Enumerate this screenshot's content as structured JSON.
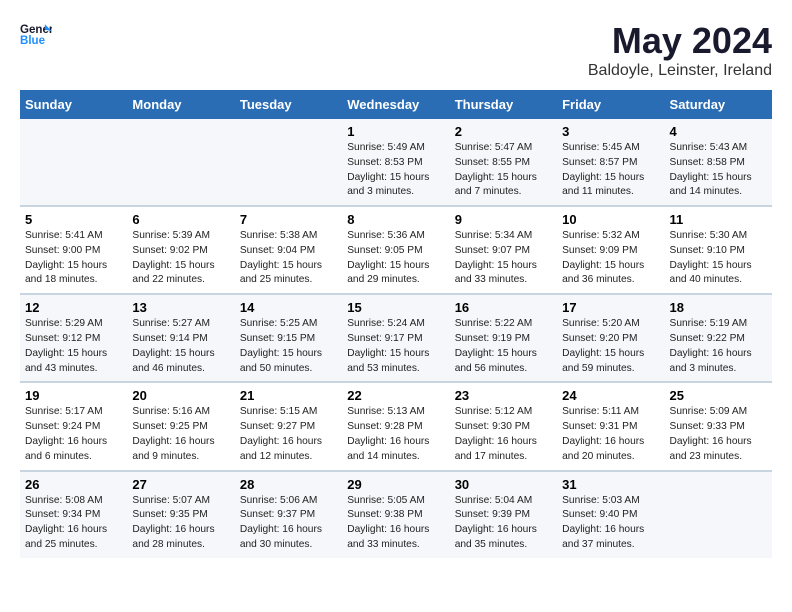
{
  "header": {
    "logo_line1": "General",
    "logo_line2": "Blue",
    "month": "May 2024",
    "location": "Baldoyle, Leinster, Ireland"
  },
  "weekdays": [
    "Sunday",
    "Monday",
    "Tuesday",
    "Wednesday",
    "Thursday",
    "Friday",
    "Saturday"
  ],
  "rows": [
    [
      {
        "day": "",
        "info": ""
      },
      {
        "day": "",
        "info": ""
      },
      {
        "day": "",
        "info": ""
      },
      {
        "day": "1",
        "info": "Sunrise: 5:49 AM\nSunset: 8:53 PM\nDaylight: 15 hours\nand 3 minutes."
      },
      {
        "day": "2",
        "info": "Sunrise: 5:47 AM\nSunset: 8:55 PM\nDaylight: 15 hours\nand 7 minutes."
      },
      {
        "day": "3",
        "info": "Sunrise: 5:45 AM\nSunset: 8:57 PM\nDaylight: 15 hours\nand 11 minutes."
      },
      {
        "day": "4",
        "info": "Sunrise: 5:43 AM\nSunset: 8:58 PM\nDaylight: 15 hours\nand 14 minutes."
      }
    ],
    [
      {
        "day": "5",
        "info": "Sunrise: 5:41 AM\nSunset: 9:00 PM\nDaylight: 15 hours\nand 18 minutes."
      },
      {
        "day": "6",
        "info": "Sunrise: 5:39 AM\nSunset: 9:02 PM\nDaylight: 15 hours\nand 22 minutes."
      },
      {
        "day": "7",
        "info": "Sunrise: 5:38 AM\nSunset: 9:04 PM\nDaylight: 15 hours\nand 25 minutes."
      },
      {
        "day": "8",
        "info": "Sunrise: 5:36 AM\nSunset: 9:05 PM\nDaylight: 15 hours\nand 29 minutes."
      },
      {
        "day": "9",
        "info": "Sunrise: 5:34 AM\nSunset: 9:07 PM\nDaylight: 15 hours\nand 33 minutes."
      },
      {
        "day": "10",
        "info": "Sunrise: 5:32 AM\nSunset: 9:09 PM\nDaylight: 15 hours\nand 36 minutes."
      },
      {
        "day": "11",
        "info": "Sunrise: 5:30 AM\nSunset: 9:10 PM\nDaylight: 15 hours\nand 40 minutes."
      }
    ],
    [
      {
        "day": "12",
        "info": "Sunrise: 5:29 AM\nSunset: 9:12 PM\nDaylight: 15 hours\nand 43 minutes."
      },
      {
        "day": "13",
        "info": "Sunrise: 5:27 AM\nSunset: 9:14 PM\nDaylight: 15 hours\nand 46 minutes."
      },
      {
        "day": "14",
        "info": "Sunrise: 5:25 AM\nSunset: 9:15 PM\nDaylight: 15 hours\nand 50 minutes."
      },
      {
        "day": "15",
        "info": "Sunrise: 5:24 AM\nSunset: 9:17 PM\nDaylight: 15 hours\nand 53 minutes."
      },
      {
        "day": "16",
        "info": "Sunrise: 5:22 AM\nSunset: 9:19 PM\nDaylight: 15 hours\nand 56 minutes."
      },
      {
        "day": "17",
        "info": "Sunrise: 5:20 AM\nSunset: 9:20 PM\nDaylight: 15 hours\nand 59 minutes."
      },
      {
        "day": "18",
        "info": "Sunrise: 5:19 AM\nSunset: 9:22 PM\nDaylight: 16 hours\nand 3 minutes."
      }
    ],
    [
      {
        "day": "19",
        "info": "Sunrise: 5:17 AM\nSunset: 9:24 PM\nDaylight: 16 hours\nand 6 minutes."
      },
      {
        "day": "20",
        "info": "Sunrise: 5:16 AM\nSunset: 9:25 PM\nDaylight: 16 hours\nand 9 minutes."
      },
      {
        "day": "21",
        "info": "Sunrise: 5:15 AM\nSunset: 9:27 PM\nDaylight: 16 hours\nand 12 minutes."
      },
      {
        "day": "22",
        "info": "Sunrise: 5:13 AM\nSunset: 9:28 PM\nDaylight: 16 hours\nand 14 minutes."
      },
      {
        "day": "23",
        "info": "Sunrise: 5:12 AM\nSunset: 9:30 PM\nDaylight: 16 hours\nand 17 minutes."
      },
      {
        "day": "24",
        "info": "Sunrise: 5:11 AM\nSunset: 9:31 PM\nDaylight: 16 hours\nand 20 minutes."
      },
      {
        "day": "25",
        "info": "Sunrise: 5:09 AM\nSunset: 9:33 PM\nDaylight: 16 hours\nand 23 minutes."
      }
    ],
    [
      {
        "day": "26",
        "info": "Sunrise: 5:08 AM\nSunset: 9:34 PM\nDaylight: 16 hours\nand 25 minutes."
      },
      {
        "day": "27",
        "info": "Sunrise: 5:07 AM\nSunset: 9:35 PM\nDaylight: 16 hours\nand 28 minutes."
      },
      {
        "day": "28",
        "info": "Sunrise: 5:06 AM\nSunset: 9:37 PM\nDaylight: 16 hours\nand 30 minutes."
      },
      {
        "day": "29",
        "info": "Sunrise: 5:05 AM\nSunset: 9:38 PM\nDaylight: 16 hours\nand 33 minutes."
      },
      {
        "day": "30",
        "info": "Sunrise: 5:04 AM\nSunset: 9:39 PM\nDaylight: 16 hours\nand 35 minutes."
      },
      {
        "day": "31",
        "info": "Sunrise: 5:03 AM\nSunset: 9:40 PM\nDaylight: 16 hours\nand 37 minutes."
      },
      {
        "day": "",
        "info": ""
      }
    ]
  ]
}
